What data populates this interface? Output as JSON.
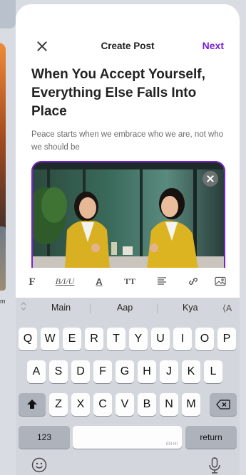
{
  "background": {
    "side_text": "m"
  },
  "header": {
    "title": "Create Post",
    "next_label": "Next"
  },
  "post": {
    "headline": "When You Accept Yourself, Everything Else Falls Into Place",
    "subtitle": "Peace starts when we embrace who we are, not who we should be",
    "image_alt": "Two women in yellow blazers laughing at a table"
  },
  "format_toolbar": {
    "font": "F",
    "style": "B/I/U",
    "color": "A",
    "size": "TT"
  },
  "keyboard": {
    "suggestions": [
      "Main",
      "Aap",
      "Kya"
    ],
    "suggest_right": "⟨A",
    "row1": [
      "Q",
      "W",
      "E",
      "R",
      "T",
      "Y",
      "U",
      "I",
      "O",
      "P"
    ],
    "row2": [
      "A",
      "S",
      "D",
      "F",
      "G",
      "H",
      "J",
      "K",
      "L"
    ],
    "row3": [
      "Z",
      "X",
      "C",
      "V",
      "B",
      "N",
      "M"
    ],
    "numbers_label": "123",
    "return_label": "return",
    "space_hint": "EN HI"
  },
  "colors": {
    "accent": "#7a1fd6",
    "keyboard_bg": "#d3d6dc"
  }
}
